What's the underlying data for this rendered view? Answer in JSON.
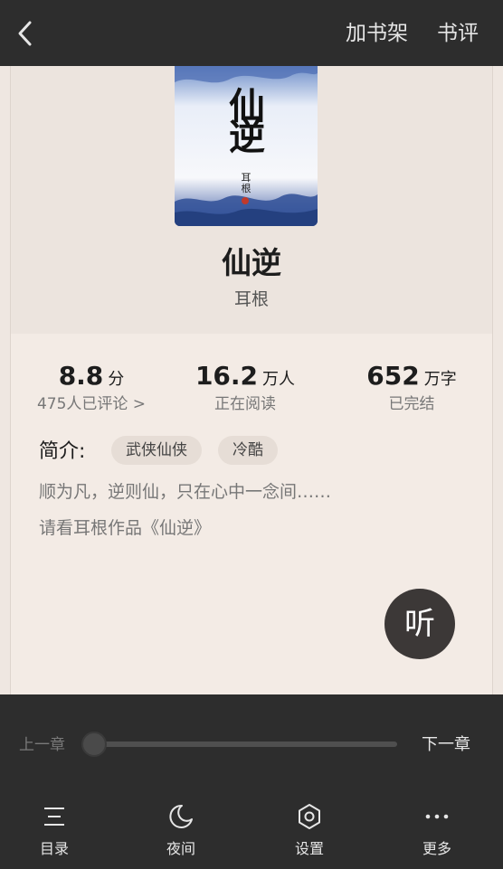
{
  "header": {
    "back_icon": "chevron-left-icon",
    "add_shelf_label": "加书架",
    "review_label": "书评"
  },
  "book": {
    "cover_title_chars": [
      "仙",
      "逆"
    ],
    "cover_author_vertical": "耳根",
    "title": "仙逆",
    "author": "耳根"
  },
  "stats": {
    "rating_value": "8.8",
    "rating_unit": "分",
    "rating_sub": "475人已评论 >",
    "readers_value": "16.2",
    "readers_unit": "万人",
    "readers_sub": "正在阅读",
    "words_value": "652",
    "words_unit": "万字",
    "words_sub": "已完结"
  },
  "intro": {
    "label": "简介:",
    "tags": [
      "武侠仙侠",
      "冷酷"
    ],
    "lines": [
      "顺为凡，逆则仙，只在心中一念间……",
      "请看耳根作品《仙逆》"
    ]
  },
  "listen_button_label": "听",
  "progress": {
    "prev_label": "上一章",
    "next_label": "下一章",
    "position_fraction": 0.0
  },
  "bottom_nav": [
    {
      "label": "目录",
      "icon": "menu-list-icon"
    },
    {
      "label": "夜间",
      "icon": "moon-icon"
    },
    {
      "label": "设置",
      "icon": "settings-hexagon-icon"
    },
    {
      "label": "更多",
      "icon": "more-dots-icon"
    }
  ],
  "colors": {
    "dark_bar": "#2d2d2d",
    "page_bg": "#f3ebe5",
    "hero_bg": "#ece4de",
    "listen_button": "#3c3837",
    "tag_bg": "#e6ddd6"
  }
}
